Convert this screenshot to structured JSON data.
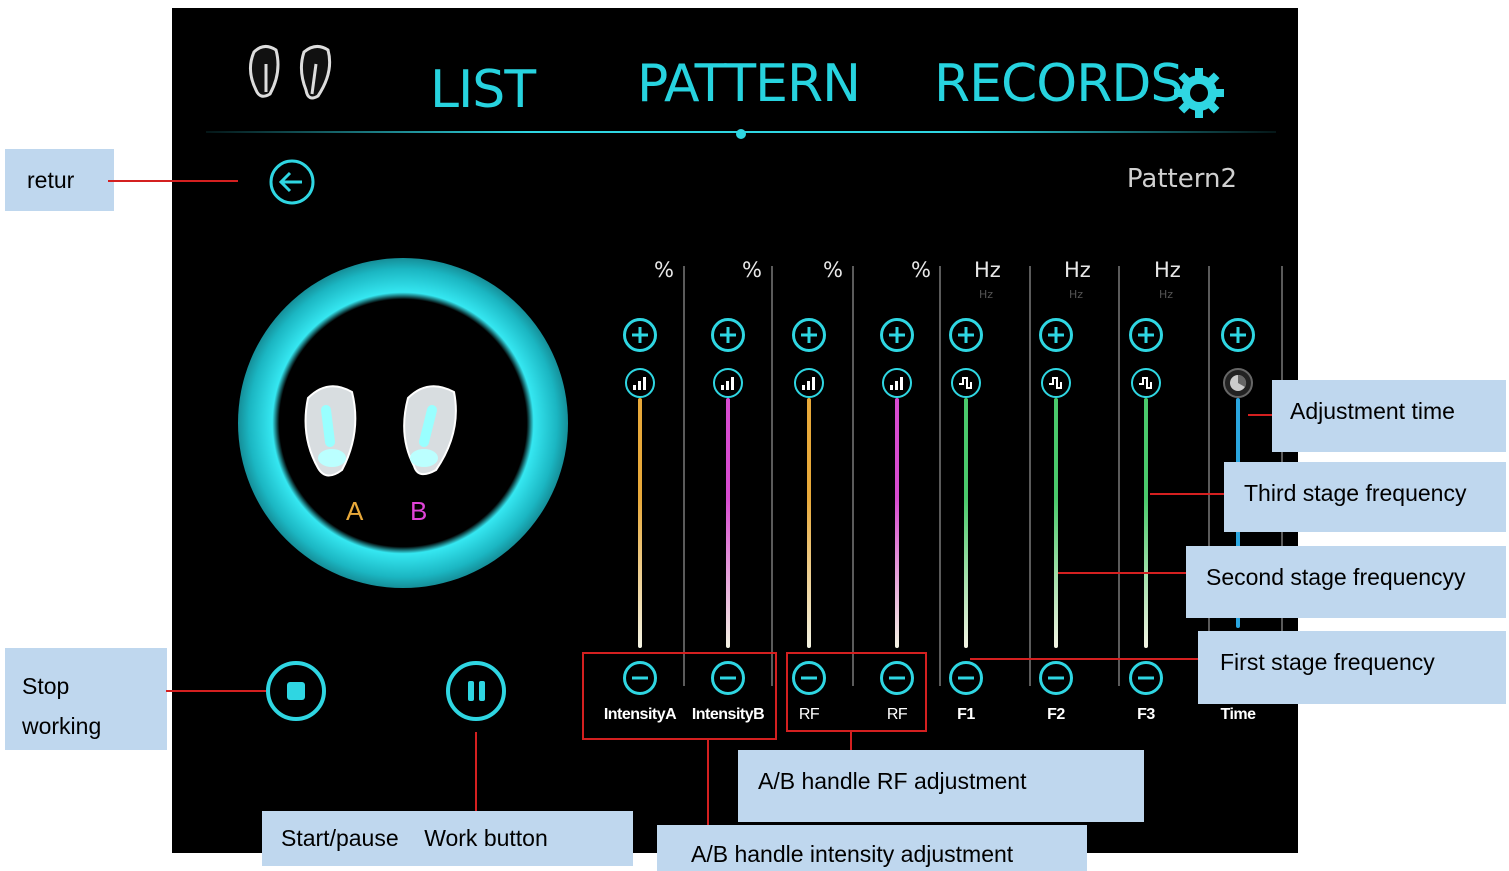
{
  "header": {
    "tabs": [
      "LIST",
      "PATTERN",
      "RECORDS"
    ],
    "active_tab": "PATTERN"
  },
  "pattern_name": "Pattern2",
  "handles": {
    "a": "A",
    "b": "B"
  },
  "sliders": [
    {
      "unit": "%",
      "sub": "",
      "label": "IntensityA",
      "color": "#e8a93a",
      "knob": "intensity"
    },
    {
      "unit": "%",
      "sub": "",
      "label": "IntensityB",
      "color": "#d84bd0",
      "knob": "intensity"
    },
    {
      "unit": "%",
      "sub": "",
      "label": "RF",
      "color": "#e8a93a",
      "knob": "intensity"
    },
    {
      "unit": "%",
      "sub": "",
      "label": "RF",
      "color": "#d84bd0",
      "knob": "intensity"
    },
    {
      "unit": "Hz",
      "sub": "Hz",
      "label": "F1",
      "color": "#49c96b",
      "knob": "wave"
    },
    {
      "unit": "Hz",
      "sub": "Hz",
      "label": "F2",
      "color": "#49c96b",
      "knob": "wave"
    },
    {
      "unit": "Hz",
      "sub": "Hz",
      "label": "F3",
      "color": "#49c96b",
      "knob": "wave"
    },
    {
      "unit": "",
      "sub": "",
      "label": "Time",
      "color": "#2aa6e0",
      "knob": "time"
    }
  ],
  "annotations": {
    "return": "retur",
    "stop": "Stop\nworking",
    "start_pause": "Start/pause    Work button",
    "adjust_time": "Adjustment time",
    "third": "Third stage frequency",
    "second": "Second stage frequencyy",
    "first": "First stage frequency",
    "rf": "A/B handle RF adjustment",
    "intensity": "A/B handle intensity adjustment"
  },
  "colors": {
    "accent": "#2fd6e2",
    "handle_a": "#e8a93a",
    "handle_b": "#d84bd0",
    "frequency": "#49c96b",
    "time": "#2aa6e0"
  }
}
